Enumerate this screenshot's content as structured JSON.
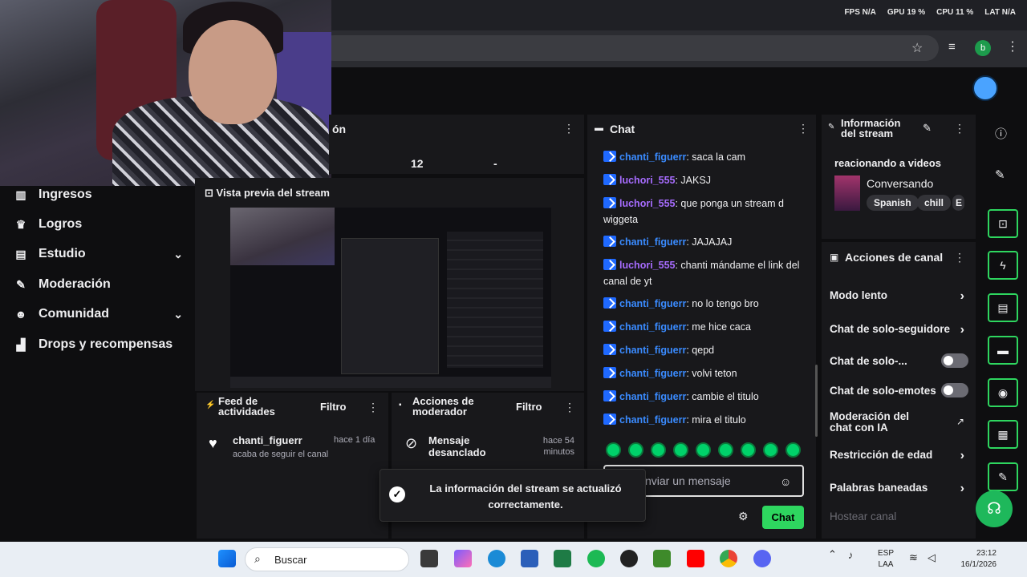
{
  "overlay": {
    "fps": "FPS N/A",
    "gpu": "GPU 19 %",
    "cpu": "CPU 11 %",
    "lat": "LAT N/A"
  },
  "sidebar": {
    "items": [
      {
        "label": "Ingresos",
        "icon": "bar-chart-icon",
        "chevron": false
      },
      {
        "label": "Logros",
        "icon": "trophy-icon",
        "chevron": false
      },
      {
        "label": "Estudio",
        "icon": "studio-icon",
        "chevron": true
      },
      {
        "label": "Moderación",
        "icon": "wrench-icon",
        "chevron": false
      },
      {
        "label": "Comunidad",
        "icon": "people-icon",
        "chevron": true
      },
      {
        "label": "Drops y recompensas",
        "icon": "drops-icon",
        "chevron": false
      }
    ]
  },
  "stats": {
    "title_tail": "ón",
    "value1": "12",
    "value2": "-"
  },
  "preview": {
    "title": "Vista previa del stream"
  },
  "feed": {
    "title": "Feed de actividades",
    "filter": "Filtro",
    "item": {
      "user": "chanti_figuerr",
      "time": "hace 1 día",
      "desc": "acaba de seguir el canal"
    }
  },
  "mod_actions": {
    "title": "Acciones de moderador",
    "filter": "Filtro",
    "item": {
      "action": "Mensaje desanclado",
      "time": "hace 54 minutos"
    }
  },
  "chat": {
    "title": "Chat",
    "messages": [
      {
        "user": "chanti_figuerr",
        "color": "blue",
        "text": ": saca la cam"
      },
      {
        "user": "luchori_555",
        "color": "purple",
        "text": ": JAKSJ"
      },
      {
        "user": "luchori_555",
        "color": "purple",
        "text": ": que ponga un stream d wiggeta"
      },
      {
        "user": "chanti_figuerr",
        "color": "blue",
        "text": ": JAJAJAJ"
      },
      {
        "user": "luchori_555",
        "color": "purple",
        "text": ": chanti mándame el link del canal de yt"
      },
      {
        "user": "chanti_figuerr",
        "color": "blue",
        "text": ": no lo tengo bro"
      },
      {
        "user": "chanti_figuerr",
        "color": "blue",
        "text": ": me hice caca"
      },
      {
        "user": "chanti_figuerr",
        "color": "blue",
        "text": ": qepd"
      },
      {
        "user": "chanti_figuerr",
        "color": "blue",
        "text": ": volvi teton"
      },
      {
        "user": "chanti_figuerr",
        "color": "blue",
        "text": ": cambie el titulo"
      },
      {
        "user": "chanti_figuerr",
        "color": "blue",
        "text": ": mira el titulo"
      }
    ],
    "input_placeholder": "nviar un mensaje",
    "send_label": "Chat"
  },
  "info": {
    "title": "Información del stream",
    "stream_title": "reacionando a videos",
    "category": "Conversando",
    "tags": [
      "Spanish",
      "chill",
      "E"
    ]
  },
  "actions": {
    "title": "Acciones de canal",
    "items": [
      {
        "label": "Modo lento",
        "control": "chevron"
      },
      {
        "label": "Chat de solo-seguidore",
        "control": "chevron"
      },
      {
        "label": "Chat de solo-...",
        "control": "toggle"
      },
      {
        "label": "Chat de solo-emotes",
        "control": "toggle"
      },
      {
        "label": "Moderación del chat con IA",
        "control": "external"
      },
      {
        "label": "Restricción de edad",
        "control": "chevron"
      },
      {
        "label": "Palabras baneadas",
        "control": "chevron"
      },
      {
        "label": "Hostear canal",
        "control": "none"
      }
    ]
  },
  "toast": {
    "text": "La información del stream se actualizó correctamente."
  },
  "taskbar": {
    "search_placeholder": "Buscar",
    "lang_line1": "ESP",
    "lang_line2": "LAA",
    "time": "23:12",
    "date": "16/1/2026"
  },
  "colors": {
    "accent": "#2ed65f",
    "chat_blue": "#3a8bff",
    "chat_purple": "#a76cff"
  }
}
